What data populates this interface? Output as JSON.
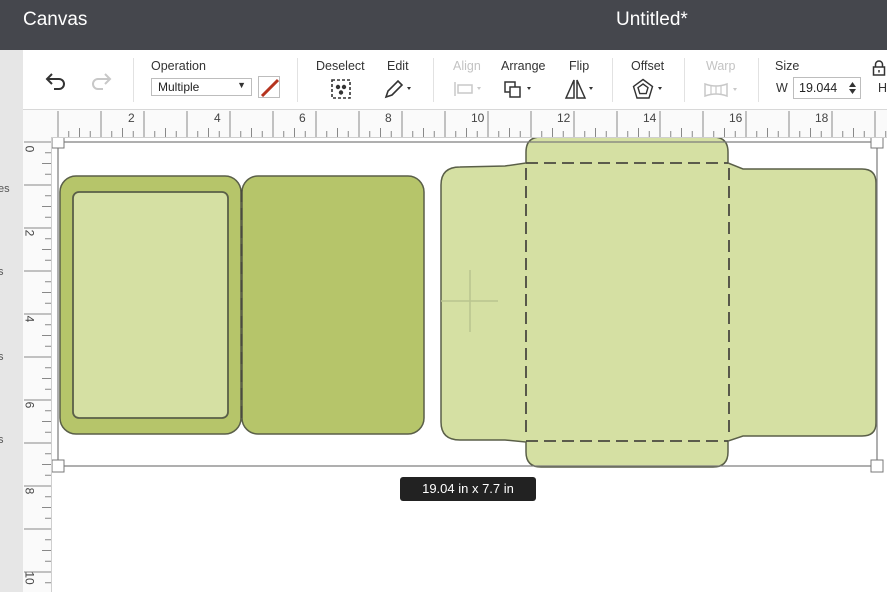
{
  "titlebar": {
    "app_title": "Canvas",
    "doc_title": "Untitled*"
  },
  "toolbar": {
    "operation_label": "Operation",
    "operation_value": "Multiple",
    "deselect_label": "Deselect",
    "edit_label": "Edit",
    "align_label": "Align",
    "arrange_label": "Arrange",
    "flip_label": "Flip",
    "offset_label": "Offset",
    "warp_label": "Warp",
    "size_label": "Size",
    "width_label": "W",
    "width_value": "19.044",
    "height_label": "H"
  },
  "left_panel": {
    "fragments": [
      "es",
      "s",
      "s",
      "s"
    ]
  },
  "rulers": {
    "top": [
      "2",
      "4",
      "6",
      "8",
      "10",
      "12",
      "14",
      "16",
      "18"
    ],
    "left": [
      "0",
      "2",
      "4",
      "6",
      "8",
      "10"
    ]
  },
  "selection": {
    "size_tooltip": "19.04  in x 7.7  in"
  },
  "colors": {
    "titlebar": "#45474d",
    "dark_green": "#b6c56a",
    "light_green": "#d5e0a3",
    "outline": "#5a5f48",
    "pen_red": "#b5341f"
  }
}
